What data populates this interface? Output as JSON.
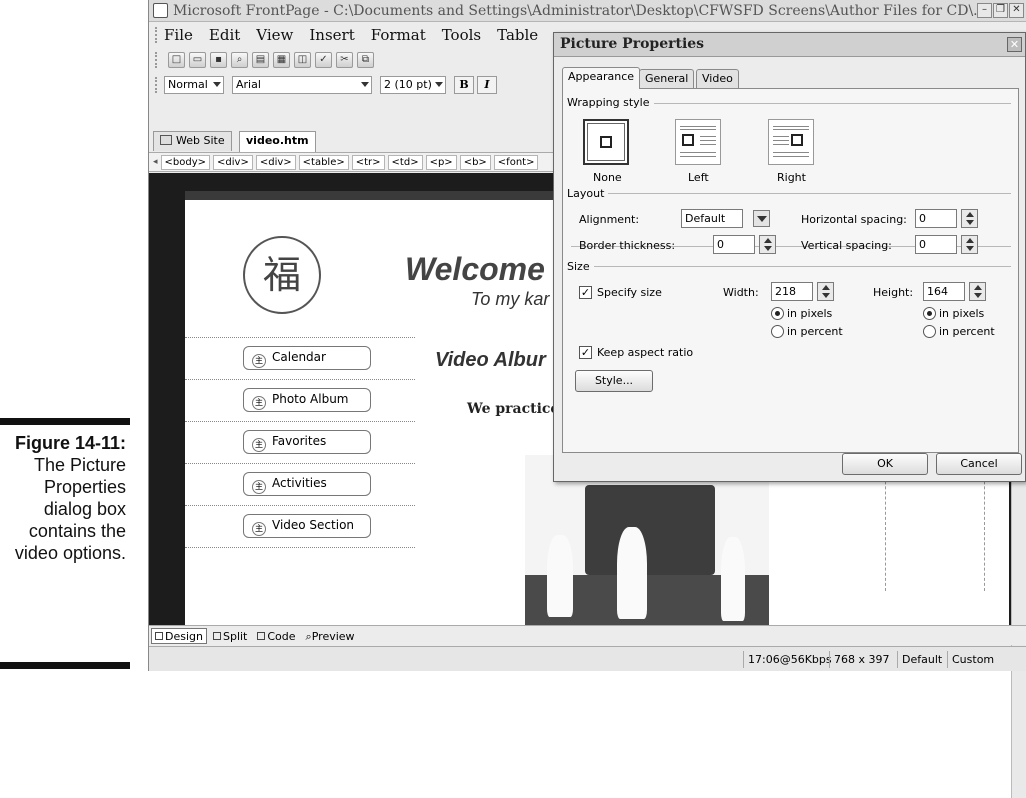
{
  "caption": {
    "figure_number": "Figure 14-11:",
    "text": "The Picture Properties dialog box contains the video options."
  },
  "window": {
    "title": "Microsoft FrontPage - C:\\Documents and Settings\\Administrator\\Desktop\\CFWSFD Screens\\Author Files for CD\\...",
    "controls": [
      "minimize",
      "restore",
      "close"
    ]
  },
  "menubar": {
    "items": [
      "File",
      "Edit",
      "View",
      "Insert",
      "Format",
      "Tools",
      "Table"
    ]
  },
  "toolbar": {
    "icons": [
      "new-icon",
      "open-icon",
      "save-icon",
      "find-icon",
      "print-icon",
      "view-icon",
      "print-preview-icon",
      "spelling-icon",
      "cut-icon",
      "copy-icon"
    ]
  },
  "format_toolbar": {
    "style_value": "Normal",
    "font_value": "Arial",
    "size_value": "2 (10 pt)",
    "bold_label": "B",
    "italic_label": "I"
  },
  "doc_tabs": {
    "website_label": "Web Site",
    "file_label": "video.htm"
  },
  "tag_selector": [
    "<body>",
    "<div>",
    "<div>",
    "<table>",
    "<tr>",
    "<td>",
    "<p>",
    "<b>",
    "<font>"
  ],
  "page": {
    "logo_char": "福",
    "welcome": "Welcome",
    "tagline": "To my kar",
    "video_album": "Video Albur",
    "we_practice": "We practice",
    "nav_items": [
      "Calendar",
      "Photo Album",
      "Favorites",
      "Activities",
      "Video Section"
    ],
    "nav_icon_char": "主"
  },
  "view_tabs": [
    "Design",
    "Split",
    "Code",
    "Preview"
  ],
  "status_bar": {
    "download": "17:06@56Kbps",
    "dimensions": "768 x 397",
    "mode": "Default",
    "custom": "Custom"
  },
  "dialog": {
    "title": "Picture Properties",
    "tabs": [
      "Appearance",
      "General",
      "Video"
    ],
    "active_tab": "Appearance",
    "wrapping_style": {
      "group_label": "Wrapping style",
      "options": [
        "None",
        "Left",
        "Right"
      ],
      "selected": "None"
    },
    "layout": {
      "group_label": "Layout",
      "alignment_label": "Alignment:",
      "alignment_value": "Default",
      "border_label": "Border thickness:",
      "border_value": "0",
      "hspace_label": "Horizontal spacing:",
      "hspace_value": "0",
      "vspace_label": "Vertical spacing:",
      "vspace_value": "0"
    },
    "size": {
      "group_label": "Size",
      "specify_label": "Specify size",
      "specify_checked": true,
      "width_label": "Width:",
      "width_value": "218",
      "height_label": "Height:",
      "height_value": "164",
      "in_pixels": "in pixels",
      "in_percent": "in percent",
      "width_unit": "pixels",
      "height_unit": "pixels",
      "keep_aspect_label": "Keep aspect ratio",
      "keep_aspect_checked": true
    },
    "style_button": "Style...",
    "ok_button": "OK",
    "cancel_button": "Cancel"
  }
}
